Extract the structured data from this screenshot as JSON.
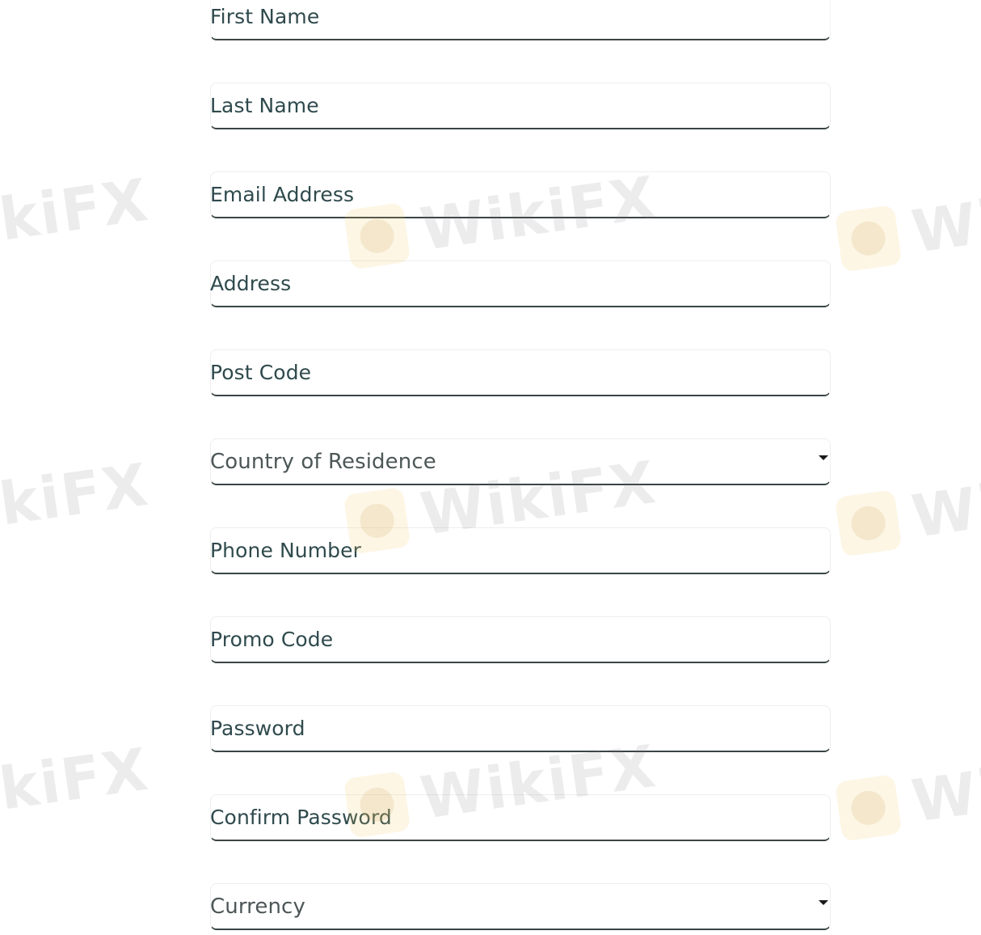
{
  "form": {
    "fields": [
      {
        "label": "First Name",
        "type": "text"
      },
      {
        "label": "Last Name",
        "type": "text"
      },
      {
        "label": "Email Address",
        "type": "text"
      },
      {
        "label": "Address",
        "type": "text"
      },
      {
        "label": "Post Code",
        "type": "text"
      },
      {
        "label": "Country of Residence",
        "type": "select",
        "icon": "caret-down-icon"
      },
      {
        "label": "Phone Number",
        "type": "text"
      },
      {
        "label": "Promo Code",
        "type": "text"
      },
      {
        "label": "Password",
        "type": "password"
      },
      {
        "label": "Confirm Password",
        "type": "password"
      },
      {
        "label": "Currency",
        "type": "select",
        "icon": "caret-down-icon"
      }
    ]
  },
  "watermark": {
    "text": "WikiFX",
    "text_partial_left": "kiFX",
    "text_partial_right": "Wi"
  },
  "colors": {
    "label_text": "#2f4a4d",
    "select_text": "#4d5758",
    "underline": "#3a4444"
  }
}
